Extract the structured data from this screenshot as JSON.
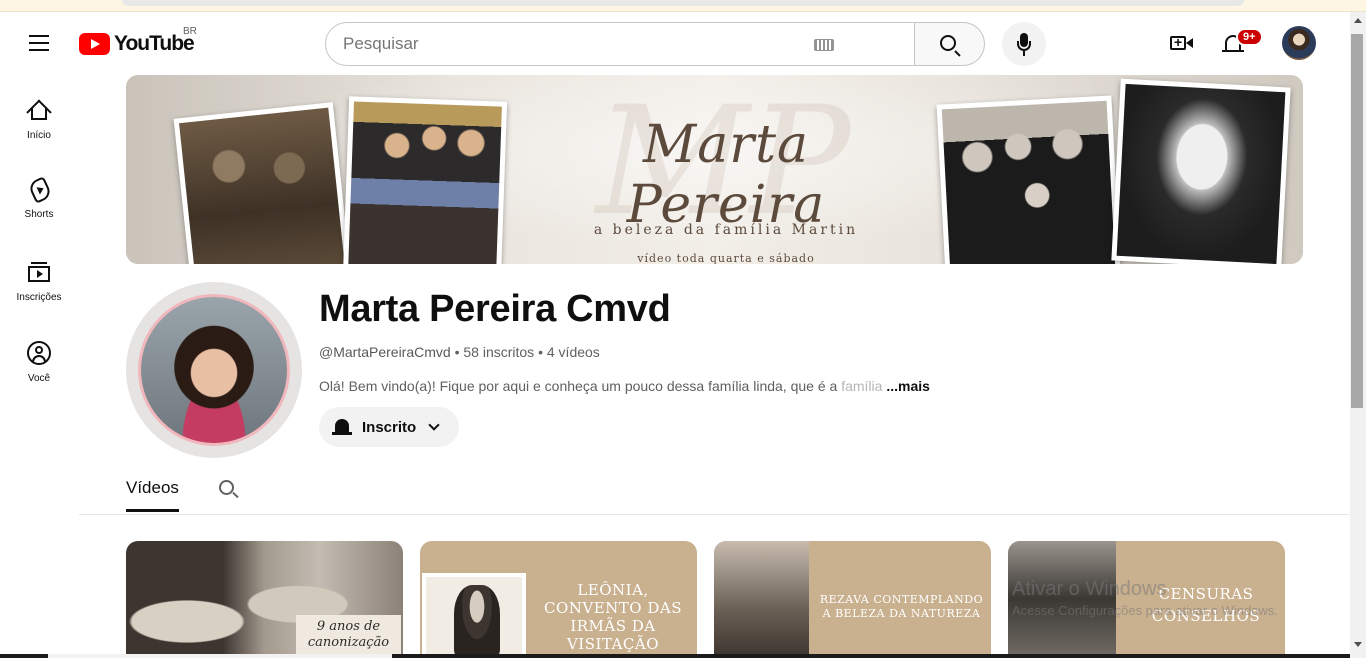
{
  "header": {
    "logo_text": "YouTube",
    "region": "BR",
    "search_placeholder": "Pesquisar",
    "notifications_badge": "9+",
    "icons": [
      "menu-icon",
      "youtube-logo",
      "keyboard-icon",
      "search-icon",
      "mic-icon",
      "create-icon",
      "bell-icon",
      "avatar"
    ]
  },
  "sidebar": {
    "items": [
      {
        "label": "Início",
        "icon": "home-icon"
      },
      {
        "label": "Shorts",
        "icon": "shorts-icon"
      },
      {
        "label": "Inscrições",
        "icon": "subscriptions-icon"
      },
      {
        "label": "Você",
        "icon": "you-icon"
      }
    ]
  },
  "banner": {
    "title": "Marta Pereira",
    "subtitle": "a beleza da família Martin",
    "schedule": "vídeo toda quarta e sábado"
  },
  "channel": {
    "name": "Marta Pereira Cmvd",
    "handle": "@MartaPereiraCmvd",
    "separator": " • ",
    "subscribers": "58 inscritos",
    "videos": "4 vídeos",
    "description": "Olá! Bem vindo(a)! Fique por aqui e conheça um pouco dessa família linda, que é a ",
    "description_fade": "família",
    "more": "...mais",
    "subscribe_label": "Inscrito"
  },
  "tabs": {
    "videos_label": "Vídeos"
  },
  "videos": [
    {
      "thumb_text": "9 anos de canonização"
    },
    {
      "thumb_text": "Leônia, convento das irmãs da visitação"
    },
    {
      "thumb_text": "Rezava contemplando a beleza da natureza"
    },
    {
      "thumb_text": "Censuras conselhos"
    }
  ],
  "watermark": {
    "line1": "Ativar o Windows",
    "line2": "Acesse Configurações para ativar o Windows."
  },
  "colors": {
    "brand_red": "#ff0000",
    "badge_red": "#cc0000",
    "thumb_tan": "#c9b08f"
  }
}
